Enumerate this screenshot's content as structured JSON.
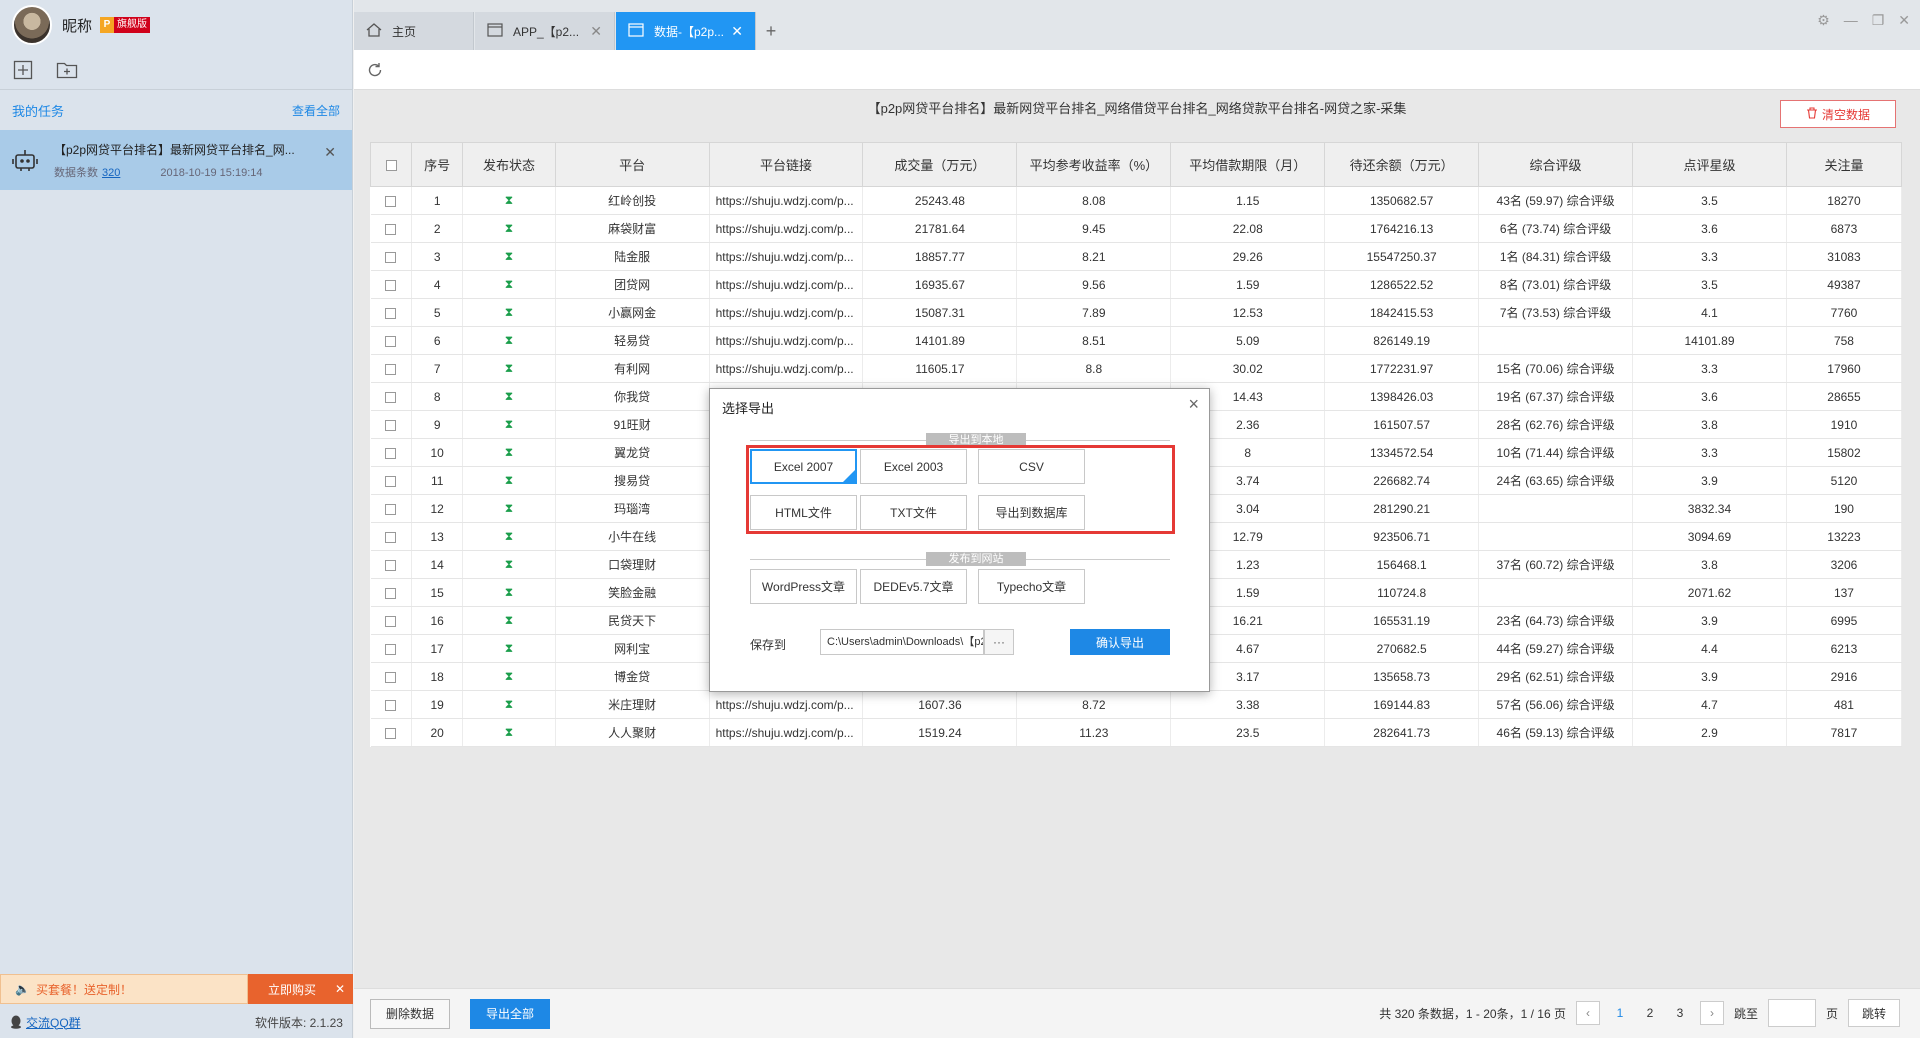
{
  "user": {
    "nickname": "昵称",
    "vip_p": "P",
    "vip_label": "旗舰版"
  },
  "sidebar": {
    "my_tasks": "我的任务",
    "view_all": "查看全部",
    "task": {
      "title": "【p2p网贷平台排名】最新网贷平台排名_网...",
      "count_label": "数据条数",
      "count": "320",
      "time": "2018-10-19 15:19:14"
    },
    "promo_text": "买套餐！送定制！",
    "promo_button": "立即购买",
    "qq_group": "交流QQ群",
    "version": "软件版本: 2.1.23"
  },
  "tabs": [
    {
      "label": "主页"
    },
    {
      "label": "APP_【p2..."
    },
    {
      "label": "数据-【p2p..."
    }
  ],
  "main": {
    "title": "【p2p网贷平台排名】最新网贷平台排名_网络借贷平台排名_网络贷款平台排名-网贷之家-采集",
    "clear_button": "清空数据"
  },
  "table": {
    "headers": [
      "序号",
      "发布状态",
      "平台",
      "平台链接",
      "成交量（万元）",
      "平均参考收益率（%）",
      "平均借款期限（月）",
      "待还余额（万元）",
      "综合评级",
      "点评星级",
      "关注量"
    ],
    "rows": [
      [
        "1",
        "红岭创投",
        "https://shuju.wdzj.com/p...",
        "25243.48",
        "8.08",
        "1.15",
        "1350682.57",
        "43名 (59.97) 综合评级",
        "3.5",
        "18270"
      ],
      [
        "2",
        "麻袋财富",
        "https://shuju.wdzj.com/p...",
        "21781.64",
        "9.45",
        "22.08",
        "1764216.13",
        "6名 (73.74) 综合评级",
        "3.6",
        "6873"
      ],
      [
        "3",
        "陆金服",
        "https://shuju.wdzj.com/p...",
        "18857.77",
        "8.21",
        "29.26",
        "15547250.37",
        "1名 (84.31) 综合评级",
        "3.3",
        "31083"
      ],
      [
        "4",
        "团贷网",
        "https://shuju.wdzj.com/p...",
        "16935.67",
        "9.56",
        "1.59",
        "1286522.52",
        "8名 (73.01) 综合评级",
        "3.5",
        "49387"
      ],
      [
        "5",
        "小赢网金",
        "https://shuju.wdzj.com/p...",
        "15087.31",
        "7.89",
        "12.53",
        "1842415.53",
        "7名 (73.53) 综合评级",
        "4.1",
        "7760"
      ],
      [
        "6",
        "轻易贷",
        "https://shuju.wdzj.com/p...",
        "14101.89",
        "8.51",
        "5.09",
        "826149.19",
        "",
        "14101.89",
        "758"
      ],
      [
        "7",
        "有利网",
        "https://shuju.wdzj.com/p...",
        "11605.17",
        "8.8",
        "30.02",
        "1772231.97",
        "15名 (70.06) 综合评级",
        "3.3",
        "17960"
      ],
      [
        "8",
        "你我贷",
        "https://shuju.wdzj.com/p...",
        "",
        "",
        "14.43",
        "1398426.03",
        "19名 (67.37) 综合评级",
        "3.6",
        "28655"
      ],
      [
        "9",
        "91旺财",
        "https://shuju.wdzj.com/p...",
        "",
        "",
        "2.36",
        "161507.57",
        "28名 (62.76) 综合评级",
        "3.8",
        "1910"
      ],
      [
        "10",
        "翼龙贷",
        "https://shuju.wdzj.com/p...",
        "",
        "",
        "8",
        "1334572.54",
        "10名 (71.44) 综合评级",
        "3.3",
        "15802"
      ],
      [
        "11",
        "搜易贷",
        "https://shuju.wdzj.com/p...",
        "",
        "",
        "3.74",
        "226682.74",
        "24名 (63.65) 综合评级",
        "3.9",
        "5120"
      ],
      [
        "12",
        "玛瑙湾",
        "https://shuju.wdzj.com/p...",
        "",
        "",
        "3.04",
        "281290.21",
        "",
        "3832.34",
        "190"
      ],
      [
        "13",
        "小牛在线",
        "https://shuju.wdzj.com/p...",
        "",
        "",
        "12.79",
        "923506.71",
        "",
        "3094.69",
        "13223"
      ],
      [
        "14",
        "口袋理财",
        "https://shuju.wdzj.com/p...",
        "",
        "",
        "1.23",
        "156468.1",
        "37名 (60.72) 综合评级",
        "3.8",
        "3206"
      ],
      [
        "15",
        "笑脸金融",
        "https://shuju.wdzj.com/p...",
        "",
        "",
        "1.59",
        "110724.8",
        "",
        "2071.62",
        "137"
      ],
      [
        "16",
        "民贷天下",
        "https://shuju.wdzj.com/p...",
        "",
        "",
        "16.21",
        "165531.19",
        "23名 (64.73) 综合评级",
        "3.9",
        "6995"
      ],
      [
        "17",
        "网利宝",
        "https://shuju.wdzj.com/p...",
        "",
        "",
        "4.67",
        "270682.5",
        "44名 (59.27) 综合评级",
        "4.4",
        "6213"
      ],
      [
        "18",
        "博金贷",
        "https://shuju.wdzj.com/p...",
        "",
        "",
        "3.17",
        "135658.73",
        "29名 (62.51) 综合评级",
        "3.9",
        "2916"
      ],
      [
        "19",
        "米庄理财",
        "https://shuju.wdzj.com/p...",
        "1607.36",
        "8.72",
        "3.38",
        "169144.83",
        "57名 (56.06) 综合评级",
        "4.7",
        "481"
      ],
      [
        "20",
        "人人聚财",
        "https://shuju.wdzj.com/p...",
        "1519.24",
        "11.23",
        "23.5",
        "282641.73",
        "46名 (59.13) 综合评级",
        "2.9",
        "7817"
      ]
    ]
  },
  "footer": {
    "delete_button": "删除数据",
    "export_all_button": "导出全部",
    "summary": "共 320 条数据，1 - 20条，1 / 16 页",
    "pages": [
      "1",
      "2",
      "3"
    ],
    "goto_label": "跳至",
    "page_unit": "页",
    "goto_button": "跳转"
  },
  "modal": {
    "title": "选择导出",
    "local_section": "导出到本地",
    "local_options": [
      "Excel 2007",
      "Excel 2003",
      "CSV",
      "HTML文件",
      "TXT文件",
      "导出到数据库"
    ],
    "publish_section": "发布到网站",
    "publish_options": [
      "WordPress文章",
      "DEDEv5.7文章",
      "Typecho文章"
    ],
    "save_to_label": "保存到",
    "save_path": "C:\\Users\\admin\\Downloads\\【p2p网",
    "browse": "···",
    "confirm": "确认导出"
  },
  "colors": {
    "accent": "#1e88e5",
    "highlight": "#e53935",
    "status_green": "#1b9e4b"
  }
}
